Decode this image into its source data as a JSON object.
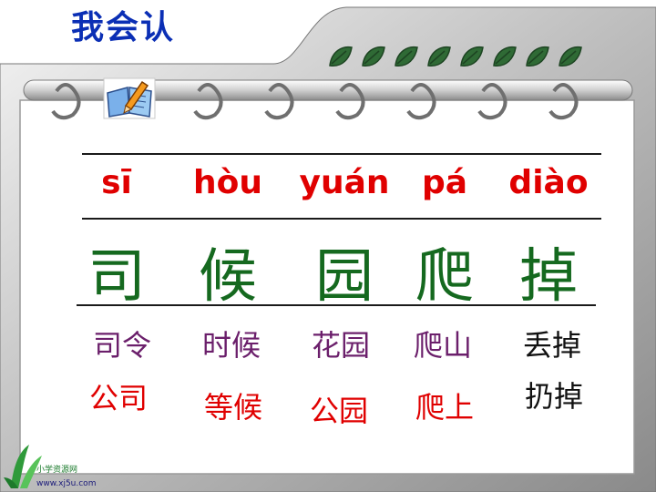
{
  "title": "我会认",
  "colors": {
    "pinyin": "#e00000",
    "hanzi": "#15691f",
    "purple_words": "#6b1f6b",
    "red_words": "#e00000",
    "black_words": "#111111"
  },
  "columns": [
    {
      "pinyin": "sī",
      "char": "司",
      "word1": "司令",
      "word2": "公司",
      "word1_color": "#6b1f6b",
      "word2_color": "#e00000"
    },
    {
      "pinyin": "hòu",
      "char": "候",
      "word1": "时候",
      "word2": "等候",
      "word1_color": "#6b1f6b",
      "word2_color": "#e00000"
    },
    {
      "pinyin": "yuán",
      "char": "园",
      "word1": "花园",
      "word2": "公园",
      "word1_color": "#6b1f6b",
      "word2_color": "#e00000"
    },
    {
      "pinyin": "pá",
      "char": "爬",
      "word1": "爬山",
      "word2": "爬上",
      "word1_color": "#6b1f6b",
      "word2_color": "#e00000"
    },
    {
      "pinyin": "diào",
      "char": "掉",
      "word1": "丢掉",
      "word2": "扔掉",
      "word1_color": "#111111",
      "word2_color": "#111111"
    }
  ],
  "logo": {
    "name": "小学资源网",
    "url": "www.xj5u.com"
  },
  "icons": [
    "leaf-icon",
    "book-pencil-icon",
    "ring-icon"
  ]
}
